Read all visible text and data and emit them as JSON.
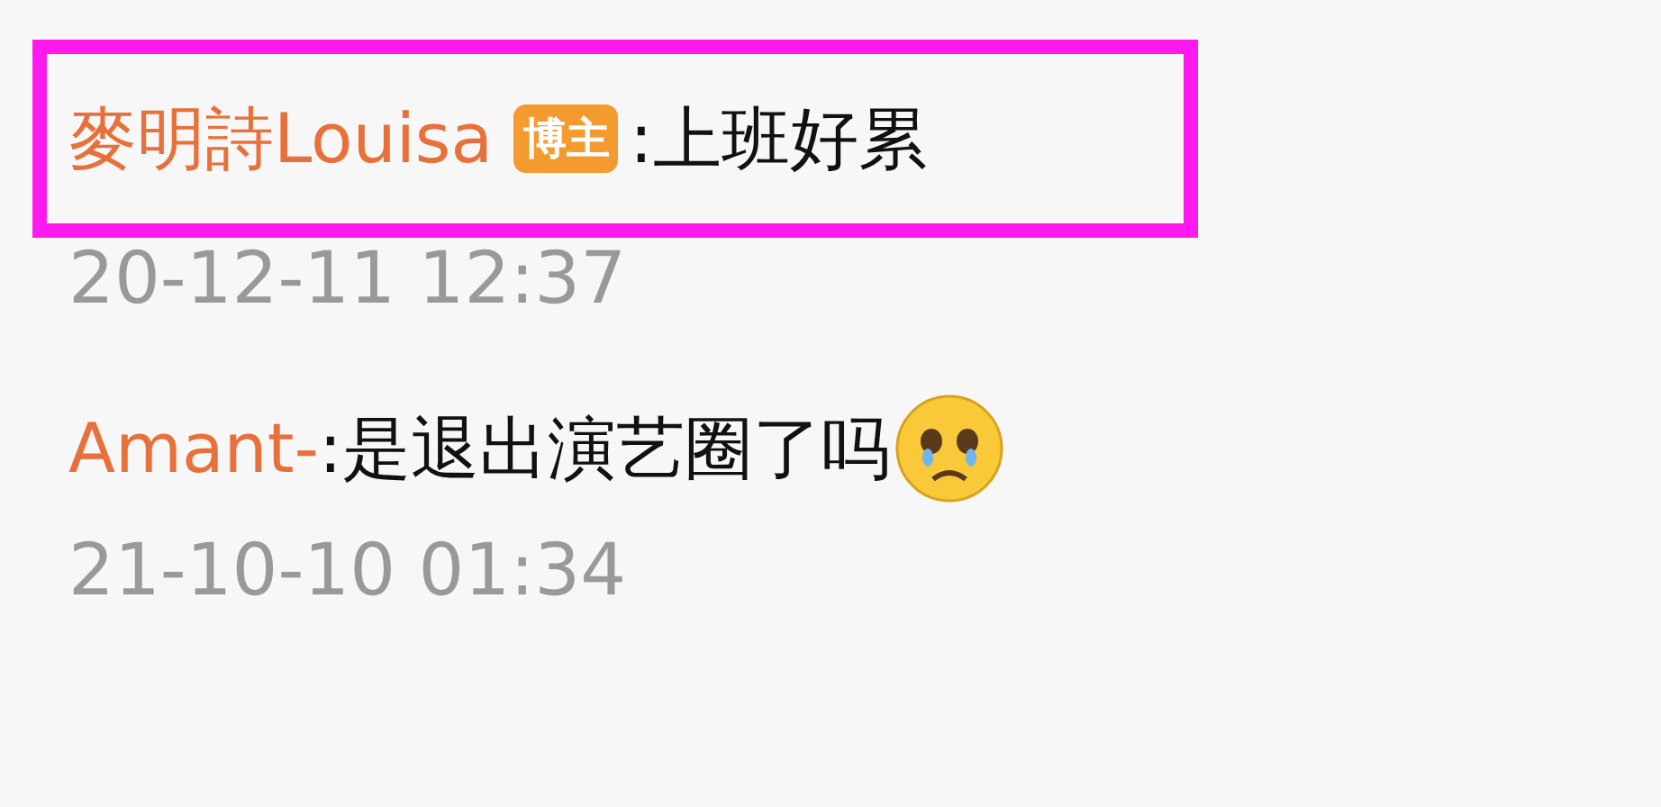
{
  "comments": [
    {
      "author": "麥明詩Louisa",
      "badge": "博主",
      "text": ":上班好累",
      "emoji": false,
      "time": "20-12-11 12:37",
      "highlighted": true
    },
    {
      "author": "Amant-",
      "text": ":是退出演艺圈了吗",
      "emoji": true,
      "time": "21-10-10 01:34",
      "highlighted": false
    }
  ]
}
